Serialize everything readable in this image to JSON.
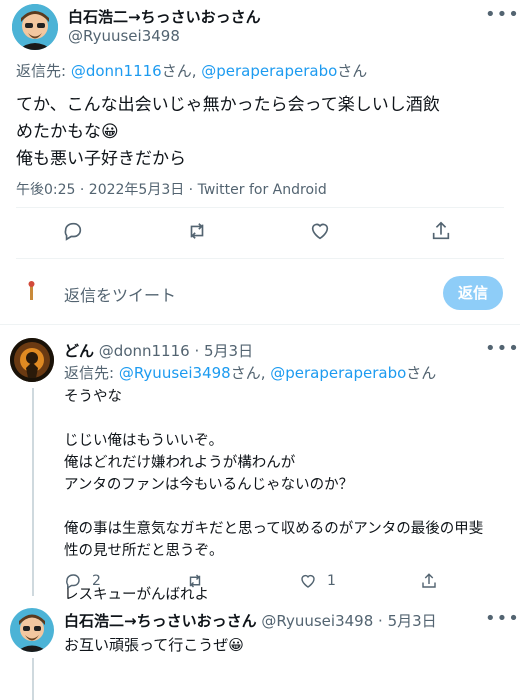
{
  "main_tweet": {
    "author_name": "白石浩二→ちっさいおっさん",
    "author_handle": "@Ryuusei3498",
    "reply_to_prefix": "返信先: ",
    "reply_to_1": "@donn1116",
    "reply_to_sep": "さん, ",
    "reply_to_2": "@peraperaperabo",
    "reply_to_suffix": "さん",
    "text_line1": "てか、こんな出会いじゃ無かったら会って楽しいし酒飲",
    "text_line2": "めたかもな😀",
    "text_line3": "俺も悪い子好きだから",
    "meta": "午後0:25 · 2022年5月3日 · Twitter for Android"
  },
  "reply_box": {
    "placeholder": "返信をツイート",
    "button_label": "返信"
  },
  "reply1": {
    "author_name": "どん",
    "author_handle": "@donn1116",
    "date": "· 5月3日",
    "reply_to_prefix": "返信先: ",
    "reply_to_1": "@Ryuusei3498",
    "reply_to_sep": "さん, ",
    "reply_to_2": "@peraperaperabo",
    "reply_to_suffix": "さん",
    "lines": [
      "そうやな",
      "",
      "じじい俺はもういいぞ。",
      "俺はどれだけ嫌われようが構わんが",
      "アンタのファンは今もいるんじゃないのか？",
      "",
      "俺の事は生意気なガキだと思って収めるのがアンタの最後の甲斐",
      "性の見せ所だと思うぞ。",
      "",
      "レスキューがんばれよ"
    ],
    "reply_count": "2",
    "like_count": "1"
  },
  "reply2": {
    "author_name": "白石浩二→ちっさいおっさん",
    "author_handle": "@Ryuusei3498",
    "date": "· 5月3日",
    "text": "お互い頑張って行こうぜ😀"
  }
}
